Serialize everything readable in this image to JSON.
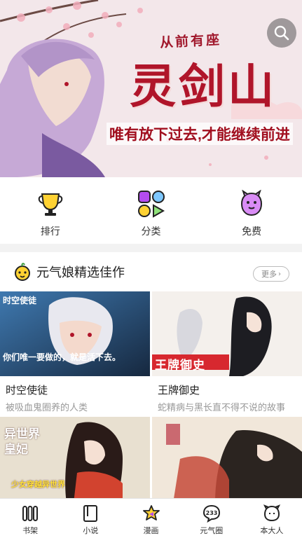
{
  "banner": {
    "subtitle": "从前有座",
    "title": "灵剑山",
    "tagline": "唯有放下过去,才能继续前进"
  },
  "categories": [
    {
      "label": "排行",
      "icon": "trophy-icon"
    },
    {
      "label": "分类",
      "icon": "shapes-icon"
    },
    {
      "label": "免费",
      "icon": "purple-monster-icon"
    }
  ],
  "section": {
    "title": "元气娘精选佳作",
    "more_label": "更多"
  },
  "cards": [
    {
      "name": "时空使徒",
      "desc": "被吸血鬼圈养的人类",
      "cover_text": "你们唯一要做的，就是活下去。",
      "cover_title": "时空使徒"
    },
    {
      "name": "王牌御史",
      "desc": "蛇精病与黑长直不得不说的故事",
      "cover_title": "王牌御史"
    },
    {
      "name": "",
      "desc": "",
      "cover_title": "异世界皇妃",
      "cover_text": "少女穿越异世界"
    },
    {
      "name": "",
      "desc": "",
      "cover_title": ""
    }
  ],
  "tabs": [
    {
      "label": "书架",
      "icon": "bookshelf-icon"
    },
    {
      "label": "小说",
      "icon": "book-icon"
    },
    {
      "label": "漫画",
      "icon": "comic-icon",
      "active": true
    },
    {
      "label": "元气圈",
      "icon": "bubble-233-icon"
    },
    {
      "label": "本大人",
      "icon": "face-icon"
    }
  ],
  "colors": {
    "accent": "#ffd233",
    "purple": "#b44cf0",
    "red": "#b0152a"
  }
}
